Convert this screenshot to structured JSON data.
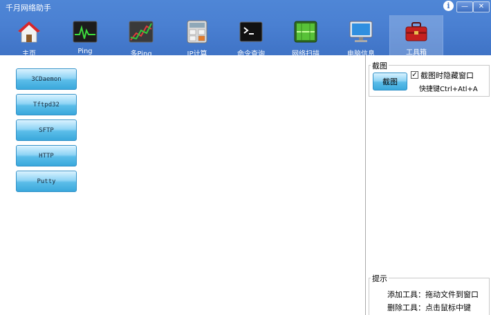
{
  "window": {
    "title": "千月网络助手",
    "info_label": "i",
    "min_label": "—",
    "close_label": "✕"
  },
  "nav": {
    "items": [
      {
        "label": "主页",
        "icon": "home-icon"
      },
      {
        "label": "Ping",
        "icon": "ping-monitor-icon"
      },
      {
        "label": "多Ping",
        "icon": "multi-ping-chart-icon"
      },
      {
        "label": "IP计算",
        "icon": "calculator-icon"
      },
      {
        "label": "命令查询",
        "icon": "terminal-icon"
      },
      {
        "label": "网络扫描",
        "icon": "network-scan-icon"
      },
      {
        "label": "电脑信息",
        "icon": "computer-monitor-icon"
      },
      {
        "label": "工具箱",
        "icon": "toolbox-icon",
        "active": true
      }
    ]
  },
  "tools": [
    {
      "label": "3CDaemon"
    },
    {
      "label": "Tftpd32"
    },
    {
      "label": "SFTP"
    },
    {
      "label": "HTTP"
    },
    {
      "label": "Putty"
    }
  ],
  "screenshot_panel": {
    "group_label": "截图",
    "button_label": "截图",
    "checkbox_label": "截图时隐藏窗口",
    "checkbox_checked_mark": "✓",
    "hotkey_text": "快捷键Ctrl+Atl+A"
  },
  "tips_panel": {
    "group_label": "提示",
    "line1": "添加工具：拖动文件到窗口",
    "line2": "删除工具：点击鼠标中键"
  }
}
